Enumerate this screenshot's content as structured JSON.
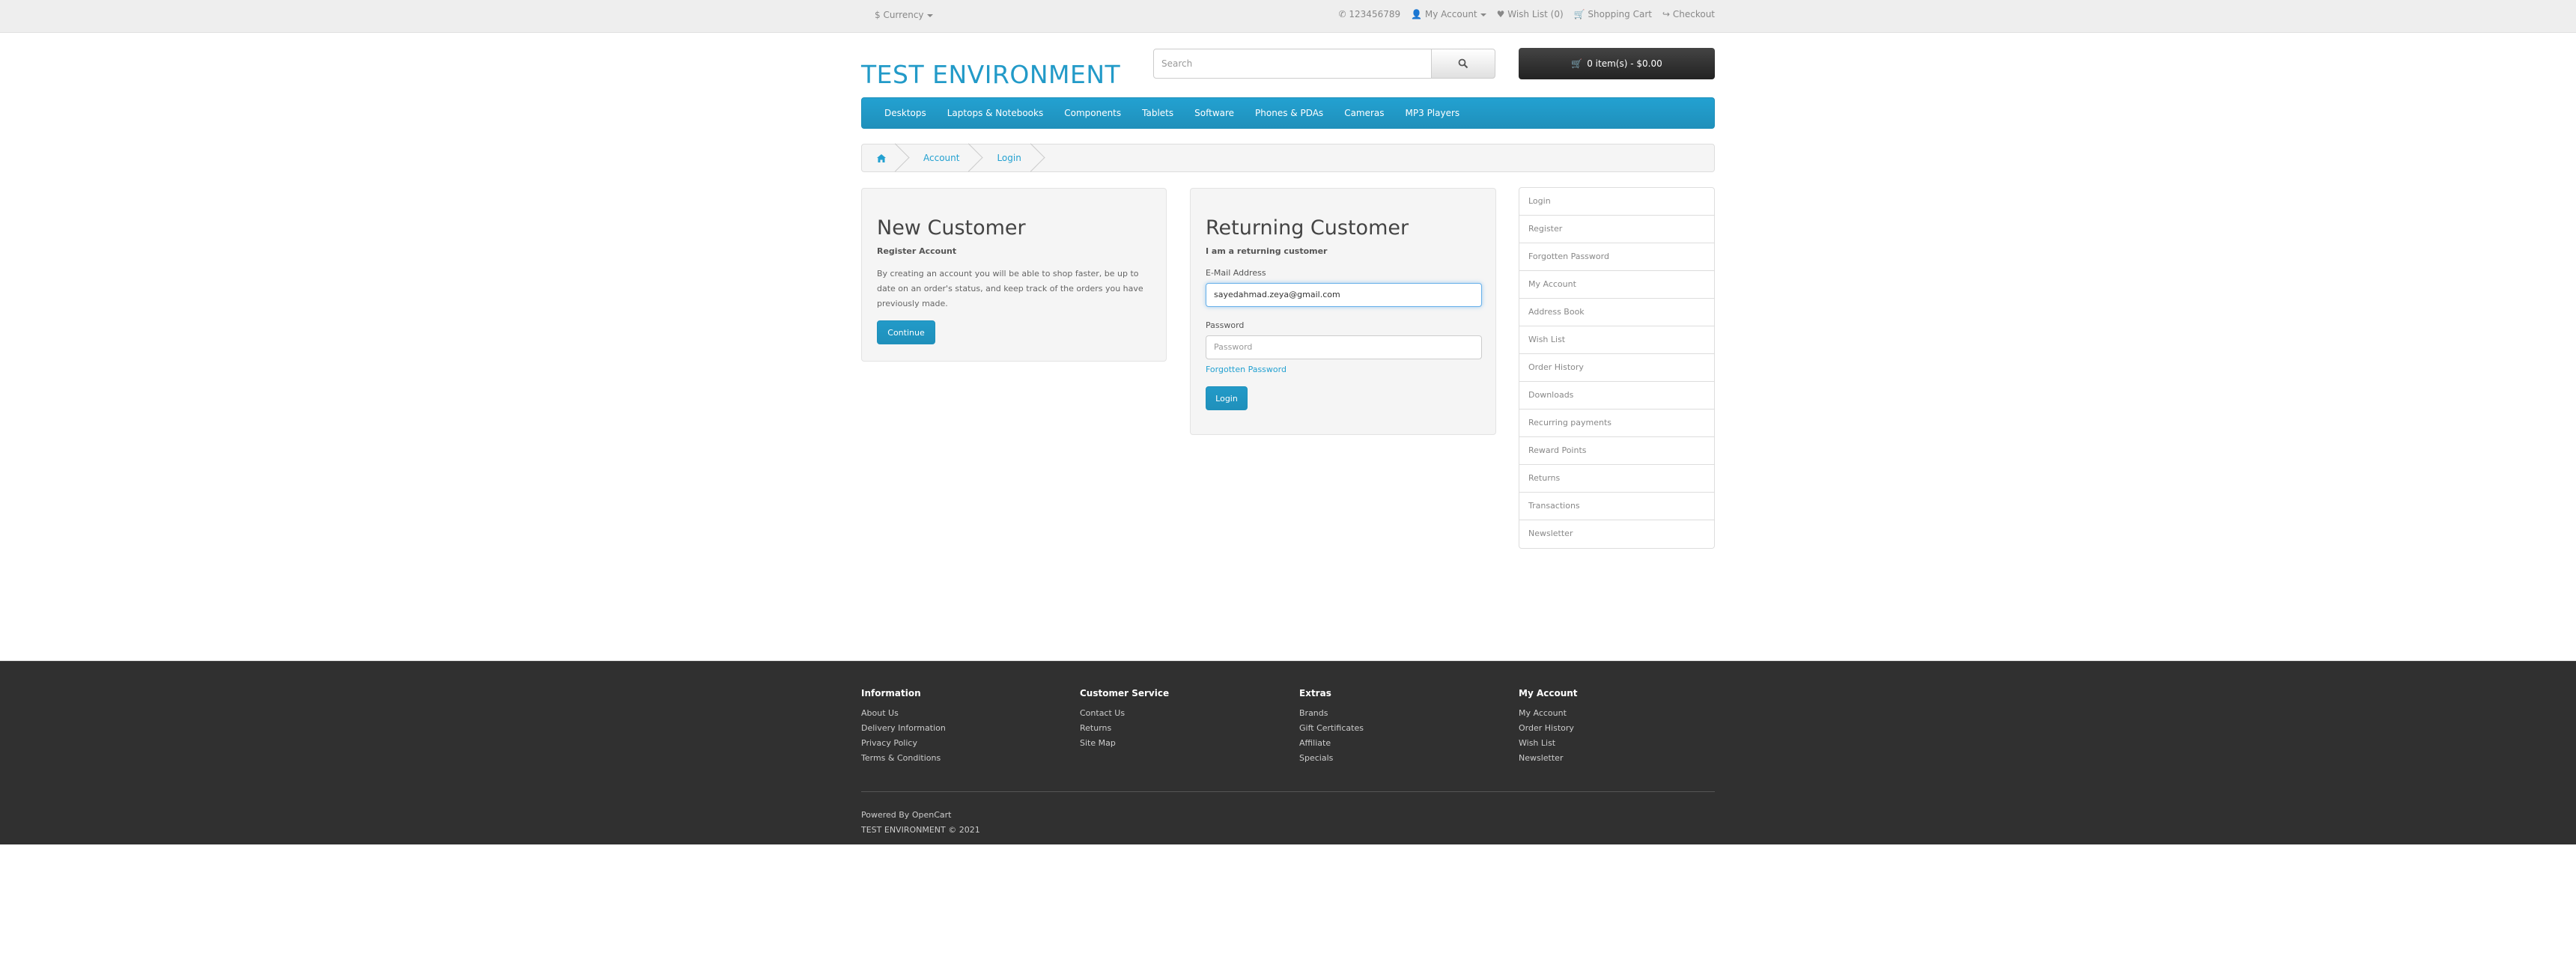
{
  "topbar": {
    "currency": "$ Currency",
    "phone": "123456789",
    "my_account": "My Account",
    "wishlist": "Wish List (0)",
    "cart": "Shopping Cart",
    "checkout": "Checkout"
  },
  "header": {
    "logo": "TEST ENVIRONMENT",
    "search_placeholder": "Search",
    "cart_button": "0 item(s) - $0.00"
  },
  "menu": [
    "Desktops",
    "Laptops & Notebooks",
    "Components",
    "Tablets",
    "Software",
    "Phones & PDAs",
    "Cameras",
    "MP3 Players"
  ],
  "breadcrumb": [
    "Account",
    "Login"
  ],
  "new_customer": {
    "title": "New Customer",
    "subtitle": "Register Account",
    "text": "By creating an account you will be able to shop faster, be up to date on an order's status, and keep track of the orders you have previously made.",
    "button": "Continue"
  },
  "returning_customer": {
    "title": "Returning Customer",
    "subtitle": "I am a returning customer",
    "email_label": "E-Mail Address",
    "email_value": "sayedahmad.zeya@gmail.com",
    "password_label": "Password",
    "password_placeholder": "Password",
    "forgotten": "Forgotten Password",
    "button": "Login"
  },
  "sidebar": [
    "Login",
    "Register",
    "Forgotten Password",
    "My Account",
    "Address Book",
    "Wish List",
    "Order History",
    "Downloads",
    "Recurring payments",
    "Reward Points",
    "Returns",
    "Transactions",
    "Newsletter"
  ],
  "footer": {
    "columns": [
      {
        "title": "Information",
        "links": [
          "About Us",
          "Delivery Information",
          "Privacy Policy",
          "Terms & Conditions"
        ]
      },
      {
        "title": "Customer Service",
        "links": [
          "Contact Us",
          "Returns",
          "Site Map"
        ]
      },
      {
        "title": "Extras",
        "links": [
          "Brands",
          "Gift Certificates",
          "Affiliate",
          "Specials"
        ]
      },
      {
        "title": "My Account",
        "links": [
          "My Account",
          "Order History",
          "Wish List",
          "Newsletter"
        ]
      }
    ],
    "powered_prefix": "Powered By",
    "powered_link": "OpenCart",
    "copyright": "TEST ENVIRONMENT © 2021"
  },
  "colors": {
    "accent": "#229ac8",
    "footer_bg": "#303030",
    "topbar_bg": "#eeeeee"
  }
}
